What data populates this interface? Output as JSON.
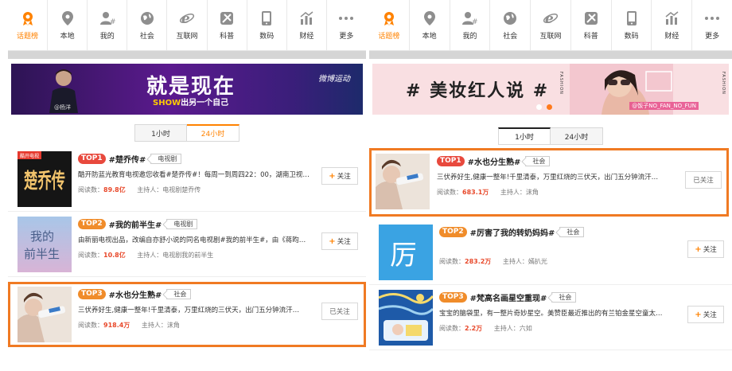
{
  "colors": {
    "accent": "#ff8200",
    "top1": "#e8493d",
    "top2": "#f08c2a",
    "highlight": "#f07a23"
  },
  "nav": [
    {
      "label": "话题榜",
      "icon": "ribbon-badge-icon"
    },
    {
      "label": "本地",
      "icon": "location-pin-icon"
    },
    {
      "label": "我的",
      "icon": "user-hash-icon"
    },
    {
      "label": "社会",
      "icon": "globe-icon"
    },
    {
      "label": "互联网",
      "icon": "browser-e-icon"
    },
    {
      "label": "科普",
      "icon": "science-icon"
    },
    {
      "label": "数码",
      "icon": "phone-icon"
    },
    {
      "label": "财经",
      "icon": "chart-icon"
    },
    {
      "label": "更多",
      "icon": "more-dots-icon"
    }
  ],
  "left": {
    "banner": {
      "slogan": "就是现在",
      "sub_a": "SHOW",
      "sub_b": "出另一个自己",
      "brand": "微博运动",
      "watermark": "@杨洋"
    },
    "tabs": [
      "1小时",
      "24小时"
    ],
    "topics": [
      {
        "rank": "TOP1",
        "title": "#楚乔传#",
        "tag": "电视剧",
        "desc": "酷开防蓝光教育电视邀您收看#楚乔传#！每周一到周四22：00，湖南卫视…",
        "reads_label": "阅读数：",
        "reads": "89.8亿",
        "host_label": "主持人：",
        "host": "电视剧楚乔传",
        "button": "关注",
        "followed": false
      },
      {
        "rank": "TOP2",
        "title": "#我的前半生#",
        "tag": "电视剧",
        "desc": "由新丽电视出品，改编自亦舒小说的同名电视剧#我的前半生#，由《蒋昀…",
        "reads_label": "阅读数：",
        "reads": "10.8亿",
        "host_label": "主持人：",
        "host": "电视剧我的前半生",
        "button": "关注",
        "followed": false
      },
      {
        "rank": "TOP3",
        "title": "#水也分生熟#",
        "tag": "社会",
        "desc": "三伏养好生,健康一整年!千里清泰，万里红烧的三伏天，出门五分钟流汗…",
        "reads_label": "阅读数：",
        "reads": "918.4万",
        "host_label": "主持人：",
        "host": "沫角",
        "button": "已关注",
        "followed": true
      }
    ],
    "thumb_texts": [
      "楚乔传",
      "酷开电视",
      "我的",
      "前半生"
    ]
  },
  "right": {
    "banner": {
      "title": "# 美妆红人说 #",
      "credit": "@饭子NO_FAN_NO_FUN",
      "fashion": "FASHION"
    },
    "tabs": [
      "1小时",
      "24小时"
    ],
    "topics": [
      {
        "rank": "TOP1",
        "title": "#水也分生熟#",
        "tag": "社会",
        "desc": "三伏养好生,健康一整年!千里清泰，万里红烧的三伏天，出门五分钟流汗…",
        "reads_label": "阅读数：",
        "reads": "683.1万",
        "host_label": "主持人：",
        "host": "沫角",
        "button": "已关注",
        "followed": true
      },
      {
        "rank": "TOP2",
        "title": "#厉害了我的转奶妈妈#",
        "tag": "社会",
        "desc": "",
        "reads_label": "阅读数：",
        "reads": "283.2万",
        "host_label": "主持人：",
        "host": "嫣扒光",
        "button": "关注",
        "followed": false
      },
      {
        "rank": "TOP3",
        "title": "#梵高名画星空重现#",
        "tag": "社会",
        "desc": "宝宝的脑袋里，有一整片奇妙星空。美赞臣最近推出的有兰铂金星空童太…",
        "reads_label": "阅读数：",
        "reads": "2.2万",
        "host_label": "主持人：",
        "host": "六如",
        "button": "关注",
        "followed": false
      }
    ],
    "thumb_texts": [
      "厉"
    ]
  }
}
